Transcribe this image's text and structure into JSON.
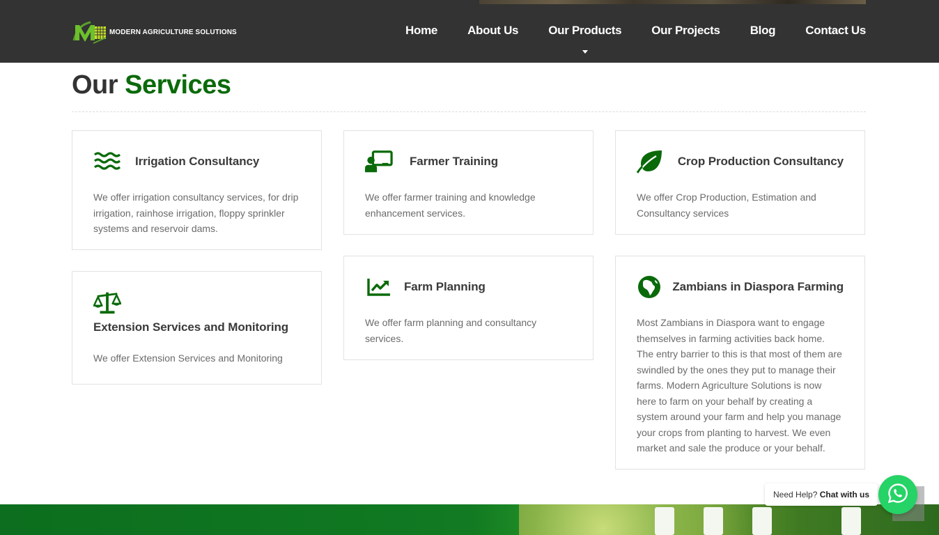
{
  "brand": {
    "name": "MODERN AGRICULTURE SOLUTIONS",
    "logo_icon": "mas-logo-icon",
    "colors": {
      "header_bg": "#333333",
      "accent_green": "#0a6a0a",
      "whatsapp": "#25d366"
    }
  },
  "nav": {
    "items": [
      {
        "label": "Home"
      },
      {
        "label": "About Us"
      },
      {
        "label": "Our Products",
        "has_dropdown": true
      },
      {
        "label": "Our Projects"
      },
      {
        "label": "Blog"
      },
      {
        "label": "Contact Us"
      }
    ]
  },
  "section": {
    "title_plain": "Our",
    "title_accent": "Services"
  },
  "services": [
    {
      "icon": "water-waves-icon",
      "title": "Irrigation Consultancy",
      "text": "We offer irrigation consultancy services, for drip irrigation, rainhose irrigation, floppy sprinkler systems and reservoir dams."
    },
    {
      "icon": "chalkboard-teacher-icon",
      "title": "Farmer Training",
      "text": "We offer farmer training and knowledge enhancement services."
    },
    {
      "icon": "leaf-icon",
      "title": "Crop Production Consultancy",
      "text": "We offer Crop Production, Estimation and Consultancy services"
    },
    {
      "icon": "balance-scale-icon",
      "title": "Extension Services and Monitoring",
      "text": "We offer Extension Services and Monitoring"
    },
    {
      "icon": "chart-line-icon",
      "title": "Farm Planning",
      "text": "We offer farm planning and consultancy services."
    },
    {
      "icon": "globe-africa-icon",
      "title": "Zambians in Diaspora Farming",
      "text": "Most Zambians in Diaspora want to engage themselves in farming activities back home. The entry barrier to this is that most of them are swindled by the ones they put to manage their farms. Modern Agriculture Solutions is now here to farm on your behalf by creating a system around your farm and help you manage your crops from planting to harvest. We even market and sale the produce or your behalf."
    }
  ],
  "chat": {
    "prefix": "Need Help?",
    "emphasis": "Chat with us",
    "icon": "whatsapp-icon"
  }
}
